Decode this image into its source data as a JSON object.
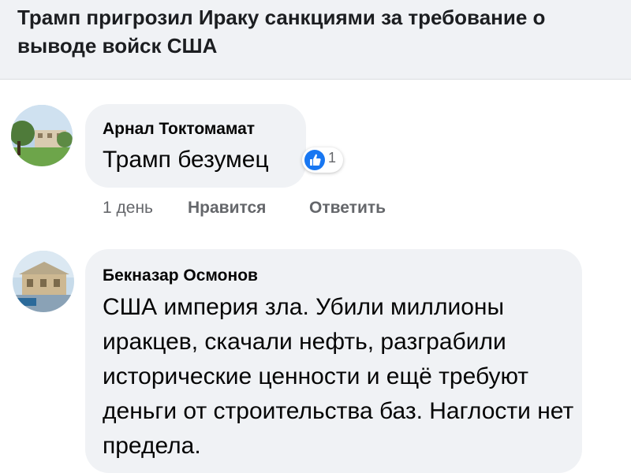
{
  "shared_link": {
    "title": "Трамп пригрозил Ираку санкциями за требование о выводе войск США"
  },
  "comments": [
    {
      "author": "Арнал Токтомамат",
      "text": "Трамп безумец",
      "reaction_icon": "like-icon",
      "reaction_count": "1",
      "time": "1 день",
      "like_label": "Нравится",
      "reply_label": "Ответить"
    },
    {
      "author": "Бекназар Осмонов",
      "text": "США империя зла. Убили миллионы иракцев, скачали нефть, разграбили исторические ценности и ещё требуют деньги от строительства баз. Наглости нет предела."
    }
  ],
  "colors": {
    "bubble": "#f0f2f5",
    "accent": "#1877f2",
    "meta_text": "#65676b"
  }
}
